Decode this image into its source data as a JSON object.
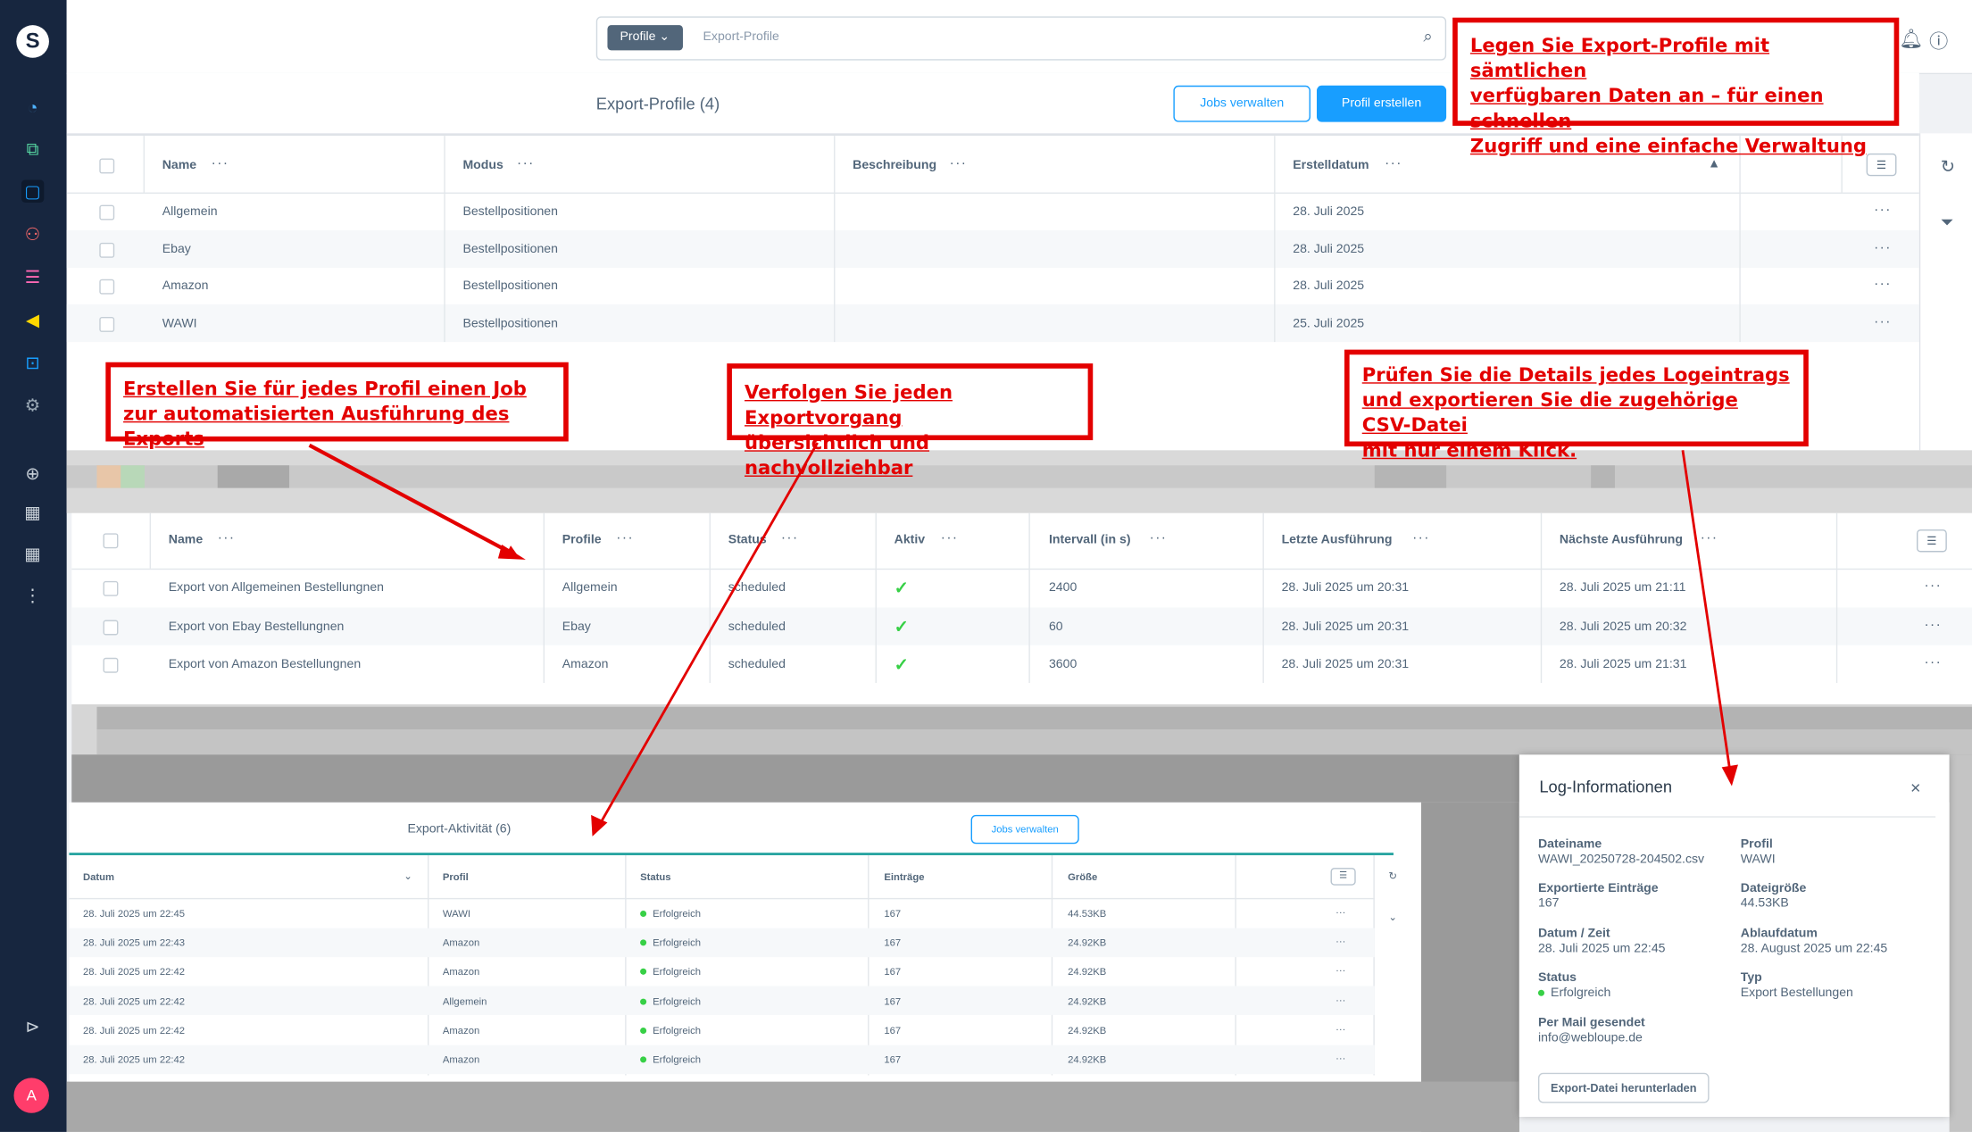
{
  "sidebar": {
    "logo": "S",
    "icons": [
      "dashboard-icon",
      "catalog-icon",
      "orders-icon",
      "customers-icon",
      "content-icon",
      "marketing-icon",
      "extensions-icon",
      "settings-icon",
      "add-icon",
      "apps-icon",
      "apps-icon",
      "more-icon"
    ],
    "avatar": "A"
  },
  "search": {
    "pill_label": "Profile",
    "placeholder": "Export-Profile"
  },
  "page": {
    "title": "Export-Profile (4)",
    "jobs_button": "Jobs verwalten",
    "create_button": "Profil erstellen"
  },
  "profiles_table": {
    "headers": {
      "name": "Name",
      "mode": "Modus",
      "description": "Beschreibung",
      "created": "Erstelldatum"
    },
    "rows": [
      {
        "name": "Allgemein",
        "mode": "Bestellpositionen",
        "description": "",
        "created": "28. Juli 2025"
      },
      {
        "name": "Ebay",
        "mode": "Bestellpositionen",
        "description": "",
        "created": "28. Juli 2025"
      },
      {
        "name": "Amazon",
        "mode": "Bestellpositionen",
        "description": "",
        "created": "28. Juli 2025"
      },
      {
        "name": "WAWI",
        "mode": "Bestellpositionen",
        "description": "",
        "created": "25. Juli 2025"
      }
    ]
  },
  "jobs_table": {
    "headers": {
      "name": "Name",
      "profile": "Profile",
      "status": "Status",
      "active": "Aktiv",
      "interval": "Intervall (in s)",
      "last": "Letzte Ausführung",
      "next": "Nächste Ausführung"
    },
    "rows": [
      {
        "name": "Export von Allgemeinen Bestellungnen",
        "profile": "Allgemein",
        "status": "scheduled",
        "interval": "2400",
        "last": "28. Juli 2025 um 20:31",
        "next": "28. Juli 2025 um 21:11"
      },
      {
        "name": "Export von Ebay Bestellungnen",
        "profile": "Ebay",
        "status": "scheduled",
        "interval": "60",
        "last": "28. Juli 2025 um 20:31",
        "next": "28. Juli 2025 um 20:32"
      },
      {
        "name": "Export von Amazon Bestellungnen",
        "profile": "Amazon",
        "status": "scheduled",
        "interval": "3600",
        "last": "28. Juli 2025 um 20:31",
        "next": "28. Juli 2025 um 21:31"
      }
    ]
  },
  "activity": {
    "title": "Export-Aktivität (6)",
    "jobs_button": "Jobs verwalten",
    "headers": {
      "date": "Datum",
      "profile": "Profil",
      "status": "Status",
      "entries": "Einträge",
      "size": "Größe"
    },
    "rows": [
      {
        "date": "28. Juli 2025 um 22:45",
        "profile": "WAWI",
        "status": "Erfolgreich",
        "entries": "167",
        "size": "44.53KB"
      },
      {
        "date": "28. Juli 2025 um 22:43",
        "profile": "Amazon",
        "status": "Erfolgreich",
        "entries": "167",
        "size": "24.92KB"
      },
      {
        "date": "28. Juli 2025 um 22:42",
        "profile": "Amazon",
        "status": "Erfolgreich",
        "entries": "167",
        "size": "24.92KB"
      },
      {
        "date": "28. Juli 2025 um 22:42",
        "profile": "Allgemein",
        "status": "Erfolgreich",
        "entries": "167",
        "size": "24.92KB"
      },
      {
        "date": "28. Juli 2025 um 22:42",
        "profile": "Amazon",
        "status": "Erfolgreich",
        "entries": "167",
        "size": "24.92KB"
      },
      {
        "date": "28. Juli 2025 um 22:42",
        "profile": "Amazon",
        "status": "Erfolgreich",
        "entries": "167",
        "size": "24.92KB"
      }
    ]
  },
  "log": {
    "title": "Log-Informationen",
    "filename_label": "Dateiname",
    "filename": "WAWI_20250728-204502.csv",
    "profile_label": "Profil",
    "profile": "WAWI",
    "entries_label": "Exportierte Einträge",
    "entries": "167",
    "size_label": "Dateigröße",
    "size": "44.53KB",
    "datetime_label": "Datum / Zeit",
    "datetime": "28. Juli 2025 um 22:45",
    "expiry_label": "Ablaufdatum",
    "expiry": "28. August 2025 um 22:45",
    "status_label": "Status",
    "status": "Erfolgreich",
    "type_label": "Typ",
    "type": "Export Bestellungen",
    "mail_label": "Per Mail gesendet",
    "mail": "info@webloupe.de",
    "download_button": "Export-Datei herunterladen"
  },
  "annotations": {
    "a1_line1": "Legen Sie Export-Profile mit sämtlichen",
    "a1_line2": "verfügbaren Daten an – für einen schnellen",
    "a1_line3": "Zugriff und eine einfache Verwaltung",
    "a2_line1": "Erstellen Sie für jedes Profil einen Job",
    "a2_line2": "zur automatisierten Ausführung des Exports",
    "a3_line1": "Verfolgen Sie jeden Exportvorgang",
    "a3_line2": "übersichtlich und nachvollziehbar",
    "a4_line1": "Prüfen Sie die Details jedes Logeintrags",
    "a4_line2": "und exportieren Sie die zugehörige CSV-Datei",
    "a4_line3": "mit nur einem Klick."
  },
  "colors": {
    "accent": "#189eff",
    "sidebar": "#17263f",
    "annotation": "#e30000",
    "success": "#37d046"
  }
}
